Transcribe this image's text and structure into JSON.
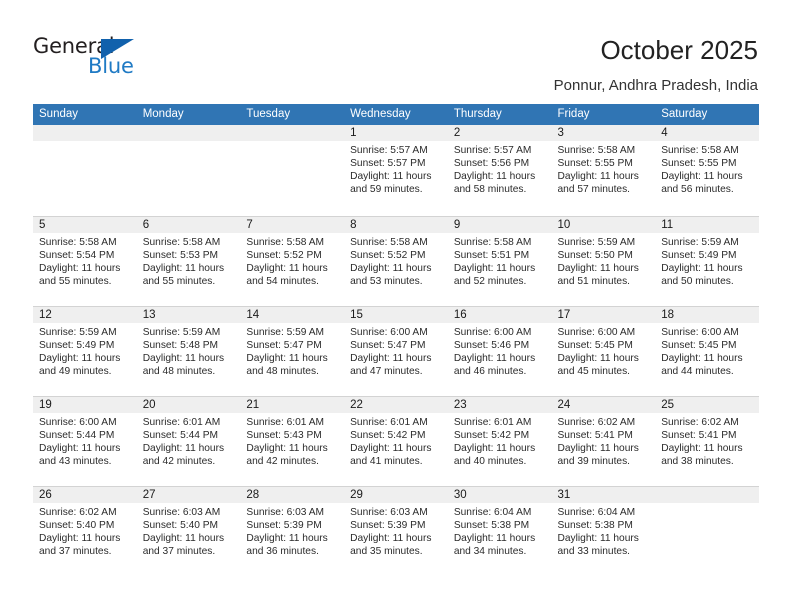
{
  "logo": {
    "word1": "General",
    "word2": "Blue",
    "triangle_color": "#1161ac",
    "blue_color": "#1f7ac4"
  },
  "header": {
    "title": "October 2025",
    "subtitle": "Ponnur, Andhra Pradesh, India"
  },
  "theme": {
    "header_bg": "#3075b4",
    "day_band_bg": "#efefef",
    "grid_line": "#d3d3d3",
    "text": "#2b2b2b"
  },
  "calendar": {
    "weekday_headers": [
      "Sunday",
      "Monday",
      "Tuesday",
      "Wednesday",
      "Thursday",
      "Friday",
      "Saturday"
    ],
    "weeks": [
      [
        {
          "day": "",
          "empty": true
        },
        {
          "day": "",
          "empty": true
        },
        {
          "day": "",
          "empty": true
        },
        {
          "day": "1",
          "sunrise": "Sunrise: 5:57 AM",
          "sunset": "Sunset: 5:57 PM",
          "daylight_line1": "Daylight: 11 hours",
          "daylight_line2": "and 59 minutes."
        },
        {
          "day": "2",
          "sunrise": "Sunrise: 5:57 AM",
          "sunset": "Sunset: 5:56 PM",
          "daylight_line1": "Daylight: 11 hours",
          "daylight_line2": "and 58 minutes."
        },
        {
          "day": "3",
          "sunrise": "Sunrise: 5:58 AM",
          "sunset": "Sunset: 5:55 PM",
          "daylight_line1": "Daylight: 11 hours",
          "daylight_line2": "and 57 minutes."
        },
        {
          "day": "4",
          "sunrise": "Sunrise: 5:58 AM",
          "sunset": "Sunset: 5:55 PM",
          "daylight_line1": "Daylight: 11 hours",
          "daylight_line2": "and 56 minutes."
        }
      ],
      [
        {
          "day": "5",
          "sunrise": "Sunrise: 5:58 AM",
          "sunset": "Sunset: 5:54 PM",
          "daylight_line1": "Daylight: 11 hours",
          "daylight_line2": "and 55 minutes."
        },
        {
          "day": "6",
          "sunrise": "Sunrise: 5:58 AM",
          "sunset": "Sunset: 5:53 PM",
          "daylight_line1": "Daylight: 11 hours",
          "daylight_line2": "and 55 minutes."
        },
        {
          "day": "7",
          "sunrise": "Sunrise: 5:58 AM",
          "sunset": "Sunset: 5:52 PM",
          "daylight_line1": "Daylight: 11 hours",
          "daylight_line2": "and 54 minutes."
        },
        {
          "day": "8",
          "sunrise": "Sunrise: 5:58 AM",
          "sunset": "Sunset: 5:52 PM",
          "daylight_line1": "Daylight: 11 hours",
          "daylight_line2": "and 53 minutes."
        },
        {
          "day": "9",
          "sunrise": "Sunrise: 5:58 AM",
          "sunset": "Sunset: 5:51 PM",
          "daylight_line1": "Daylight: 11 hours",
          "daylight_line2": "and 52 minutes."
        },
        {
          "day": "10",
          "sunrise": "Sunrise: 5:59 AM",
          "sunset": "Sunset: 5:50 PM",
          "daylight_line1": "Daylight: 11 hours",
          "daylight_line2": "and 51 minutes."
        },
        {
          "day": "11",
          "sunrise": "Sunrise: 5:59 AM",
          "sunset": "Sunset: 5:49 PM",
          "daylight_line1": "Daylight: 11 hours",
          "daylight_line2": "and 50 minutes."
        }
      ],
      [
        {
          "day": "12",
          "sunrise": "Sunrise: 5:59 AM",
          "sunset": "Sunset: 5:49 PM",
          "daylight_line1": "Daylight: 11 hours",
          "daylight_line2": "and 49 minutes."
        },
        {
          "day": "13",
          "sunrise": "Sunrise: 5:59 AM",
          "sunset": "Sunset: 5:48 PM",
          "daylight_line1": "Daylight: 11 hours",
          "daylight_line2": "and 48 minutes."
        },
        {
          "day": "14",
          "sunrise": "Sunrise: 5:59 AM",
          "sunset": "Sunset: 5:47 PM",
          "daylight_line1": "Daylight: 11 hours",
          "daylight_line2": "and 48 minutes."
        },
        {
          "day": "15",
          "sunrise": "Sunrise: 6:00 AM",
          "sunset": "Sunset: 5:47 PM",
          "daylight_line1": "Daylight: 11 hours",
          "daylight_line2": "and 47 minutes."
        },
        {
          "day": "16",
          "sunrise": "Sunrise: 6:00 AM",
          "sunset": "Sunset: 5:46 PM",
          "daylight_line1": "Daylight: 11 hours",
          "daylight_line2": "and 46 minutes."
        },
        {
          "day": "17",
          "sunrise": "Sunrise: 6:00 AM",
          "sunset": "Sunset: 5:45 PM",
          "daylight_line1": "Daylight: 11 hours",
          "daylight_line2": "and 45 minutes."
        },
        {
          "day": "18",
          "sunrise": "Sunrise: 6:00 AM",
          "sunset": "Sunset: 5:45 PM",
          "daylight_line1": "Daylight: 11 hours",
          "daylight_line2": "and 44 minutes."
        }
      ],
      [
        {
          "day": "19",
          "sunrise": "Sunrise: 6:00 AM",
          "sunset": "Sunset: 5:44 PM",
          "daylight_line1": "Daylight: 11 hours",
          "daylight_line2": "and 43 minutes."
        },
        {
          "day": "20",
          "sunrise": "Sunrise: 6:01 AM",
          "sunset": "Sunset: 5:44 PM",
          "daylight_line1": "Daylight: 11 hours",
          "daylight_line2": "and 42 minutes."
        },
        {
          "day": "21",
          "sunrise": "Sunrise: 6:01 AM",
          "sunset": "Sunset: 5:43 PM",
          "daylight_line1": "Daylight: 11 hours",
          "daylight_line2": "and 42 minutes."
        },
        {
          "day": "22",
          "sunrise": "Sunrise: 6:01 AM",
          "sunset": "Sunset: 5:42 PM",
          "daylight_line1": "Daylight: 11 hours",
          "daylight_line2": "and 41 minutes."
        },
        {
          "day": "23",
          "sunrise": "Sunrise: 6:01 AM",
          "sunset": "Sunset: 5:42 PM",
          "daylight_line1": "Daylight: 11 hours",
          "daylight_line2": "and 40 minutes."
        },
        {
          "day": "24",
          "sunrise": "Sunrise: 6:02 AM",
          "sunset": "Sunset: 5:41 PM",
          "daylight_line1": "Daylight: 11 hours",
          "daylight_line2": "and 39 minutes."
        },
        {
          "day": "25",
          "sunrise": "Sunrise: 6:02 AM",
          "sunset": "Sunset: 5:41 PM",
          "daylight_line1": "Daylight: 11 hours",
          "daylight_line2": "and 38 minutes."
        }
      ],
      [
        {
          "day": "26",
          "sunrise": "Sunrise: 6:02 AM",
          "sunset": "Sunset: 5:40 PM",
          "daylight_line1": "Daylight: 11 hours",
          "daylight_line2": "and 37 minutes."
        },
        {
          "day": "27",
          "sunrise": "Sunrise: 6:03 AM",
          "sunset": "Sunset: 5:40 PM",
          "daylight_line1": "Daylight: 11 hours",
          "daylight_line2": "and 37 minutes."
        },
        {
          "day": "28",
          "sunrise": "Sunrise: 6:03 AM",
          "sunset": "Sunset: 5:39 PM",
          "daylight_line1": "Daylight: 11 hours",
          "daylight_line2": "and 36 minutes."
        },
        {
          "day": "29",
          "sunrise": "Sunrise: 6:03 AM",
          "sunset": "Sunset: 5:39 PM",
          "daylight_line1": "Daylight: 11 hours",
          "daylight_line2": "and 35 minutes."
        },
        {
          "day": "30",
          "sunrise": "Sunrise: 6:04 AM",
          "sunset": "Sunset: 5:38 PM",
          "daylight_line1": "Daylight: 11 hours",
          "daylight_line2": "and 34 minutes."
        },
        {
          "day": "31",
          "sunrise": "Sunrise: 6:04 AM",
          "sunset": "Sunset: 5:38 PM",
          "daylight_line1": "Daylight: 11 hours",
          "daylight_line2": "and 33 minutes."
        },
        {
          "day": "",
          "empty": true
        }
      ]
    ]
  }
}
